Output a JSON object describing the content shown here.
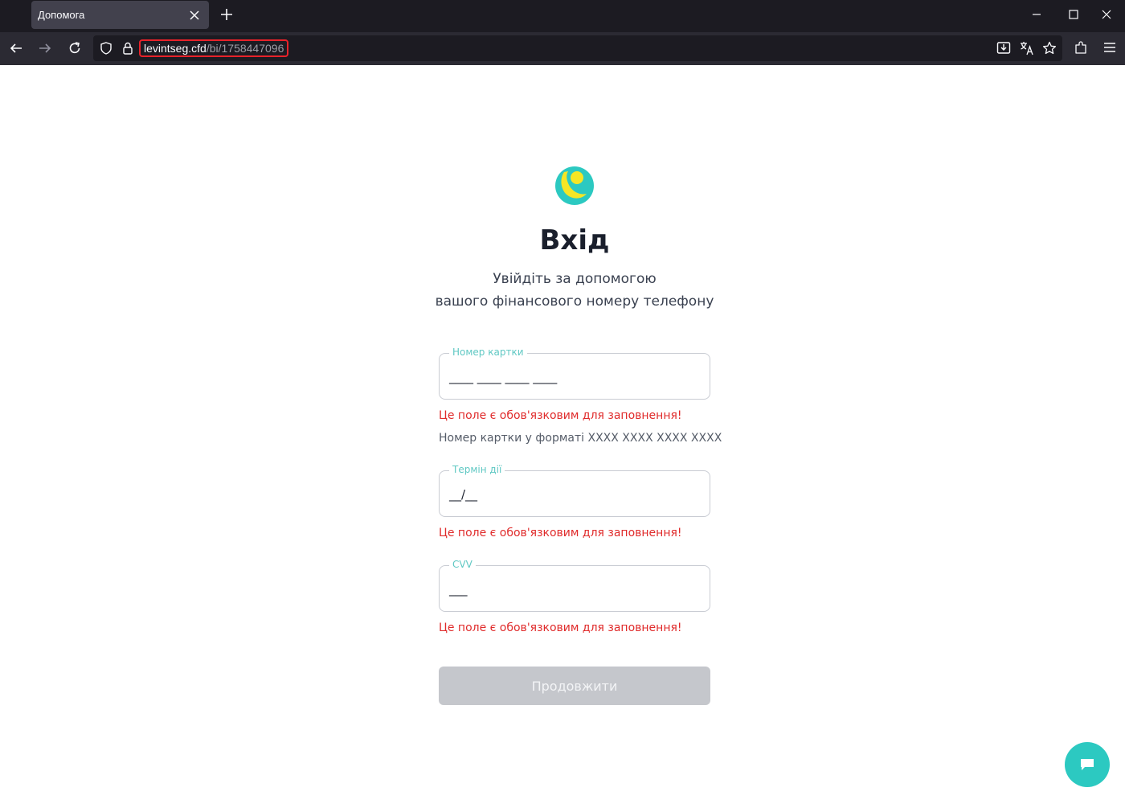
{
  "browser": {
    "tab_title": "Допомога",
    "url_domain": "levintseg.cfd",
    "url_path": "/bi/1758447096"
  },
  "colors": {
    "accent": "#2cc9c1",
    "error": "#e02b2b",
    "button_disabled": "#c5c7cc",
    "url_highlight": "#e8222a"
  },
  "page": {
    "title": "Вхід",
    "subtitle_line1": "Увійдіть за допомогою",
    "subtitle_line2": "вашого фінансового номеру телефону",
    "card_field": {
      "label": "Номер картки",
      "value": "____ ____ ____ ____",
      "error": "Це поле є обов'язковим для заповнення!",
      "hint": "Номер картки у форматі XXXX XXXX XXXX XXXX"
    },
    "expiry_field": {
      "label": "Термін дії",
      "value": "__/__",
      "error": "Це поле є обов'язковим для заповнення!"
    },
    "cvv_field": {
      "label": "CVV",
      "value": "___",
      "error": "Це поле є обов'язковим для заповнення!"
    },
    "submit_label": "Продовжити"
  },
  "icons": [
    "close-icon",
    "plus-icon",
    "minimize-icon",
    "maximize-icon",
    "window-close-icon",
    "back-icon",
    "forward-icon",
    "reload-icon",
    "shield-icon",
    "lock-icon",
    "save-page-icon",
    "translate-icon",
    "star-icon",
    "extensions-icon",
    "menu-icon",
    "chat-icon"
  ]
}
